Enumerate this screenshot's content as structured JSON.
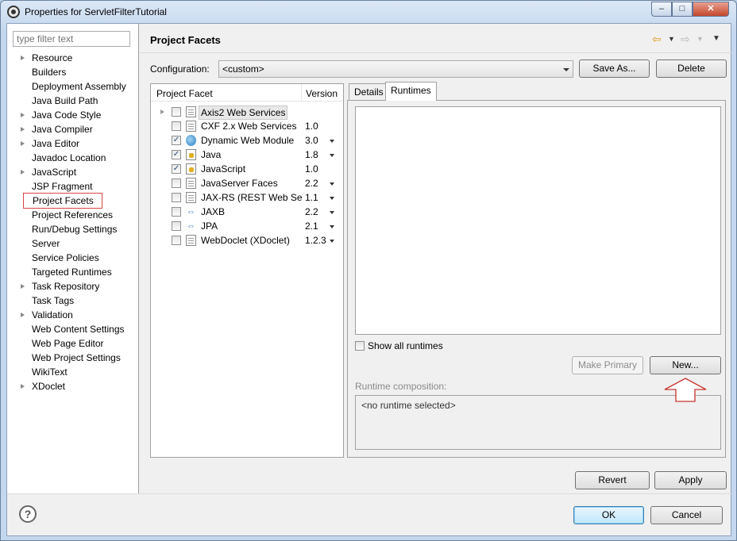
{
  "window": {
    "title": "Properties for ServletFilterTutorial",
    "controls": {
      "minimize": "–",
      "maximize": "□",
      "close": "✕"
    }
  },
  "sidebar": {
    "filter_placeholder": "type filter text",
    "items": [
      {
        "label": "Resource",
        "expandable": true
      },
      {
        "label": "Builders",
        "expandable": false
      },
      {
        "label": "Deployment Assembly",
        "expandable": false
      },
      {
        "label": "Java Build Path",
        "expandable": false
      },
      {
        "label": "Java Code Style",
        "expandable": true
      },
      {
        "label": "Java Compiler",
        "expandable": true
      },
      {
        "label": "Java Editor",
        "expandable": true
      },
      {
        "label": "Javadoc Location",
        "expandable": false
      },
      {
        "label": "JavaScript",
        "expandable": true
      },
      {
        "label": "JSP Fragment",
        "expandable": false
      },
      {
        "label": "Project Facets",
        "expandable": false,
        "selected": true
      },
      {
        "label": "Project References",
        "expandable": false
      },
      {
        "label": "Run/Debug Settings",
        "expandable": false
      },
      {
        "label": "Server",
        "expandable": false
      },
      {
        "label": "Service Policies",
        "expandable": false
      },
      {
        "label": "Targeted Runtimes",
        "expandable": false
      },
      {
        "label": "Task Repository",
        "expandable": true
      },
      {
        "label": "Task Tags",
        "expandable": false
      },
      {
        "label": "Validation",
        "expandable": true
      },
      {
        "label": "Web Content Settings",
        "expandable": false
      },
      {
        "label": "Web Page Editor",
        "expandable": false
      },
      {
        "label": "Web Project Settings",
        "expandable": false
      },
      {
        "label": "WikiText",
        "expandable": false
      },
      {
        "label": "XDoclet",
        "expandable": true
      }
    ]
  },
  "page": {
    "title": "Project Facets",
    "configuration_label": "Configuration:",
    "configuration_value": "<custom>",
    "save_as_label": "Save As...",
    "delete_label": "Delete"
  },
  "facets": {
    "col_facet": "Project Facet",
    "col_version": "Version",
    "rows": [
      {
        "name": "Axis2 Web Services",
        "version": "",
        "checked": false,
        "icon": "doc",
        "expandable": true,
        "highlighted": true,
        "dropdown": false
      },
      {
        "name": "CXF 2.x Web Services",
        "version": "1.0",
        "checked": false,
        "icon": "doc",
        "dropdown": false
      },
      {
        "name": "Dynamic Web Module",
        "version": "3.0",
        "checked": true,
        "icon": "web",
        "dropdown": true
      },
      {
        "name": "Java",
        "version": "1.8",
        "checked": true,
        "icon": "java",
        "dropdown": true
      },
      {
        "name": "JavaScript",
        "version": "1.0",
        "checked": true,
        "icon": "java",
        "dropdown": false
      },
      {
        "name": "JavaServer Faces",
        "version": "2.2",
        "checked": false,
        "icon": "doc",
        "dropdown": true
      },
      {
        "name": "JAX-RS (REST Web Services)",
        "version": "1.1",
        "checked": false,
        "icon": "doc",
        "dropdown": true
      },
      {
        "name": "JAXB",
        "version": "2.2",
        "checked": false,
        "icon": "arrows",
        "dropdown": true
      },
      {
        "name": "JPA",
        "version": "2.1",
        "checked": false,
        "icon": "arrows",
        "dropdown": true
      },
      {
        "name": "WebDoclet (XDoclet)",
        "version": "1.2.3",
        "checked": false,
        "icon": "doc",
        "dropdown": true
      }
    ]
  },
  "tabs": {
    "details": "Details",
    "runtimes": "Runtimes"
  },
  "runtimes_panel": {
    "show_all_label": "Show all runtimes",
    "make_primary_label": "Make Primary",
    "new_label": "New...",
    "composition_label": "Runtime composition:",
    "composition_value": "<no runtime selected>"
  },
  "footer": {
    "revert_label": "Revert",
    "apply_label": "Apply",
    "ok_label": "OK",
    "cancel_label": "Cancel",
    "help": "?"
  },
  "colors": {
    "selection_border": "#d84545",
    "annotation_arrow": "#c8352d"
  }
}
